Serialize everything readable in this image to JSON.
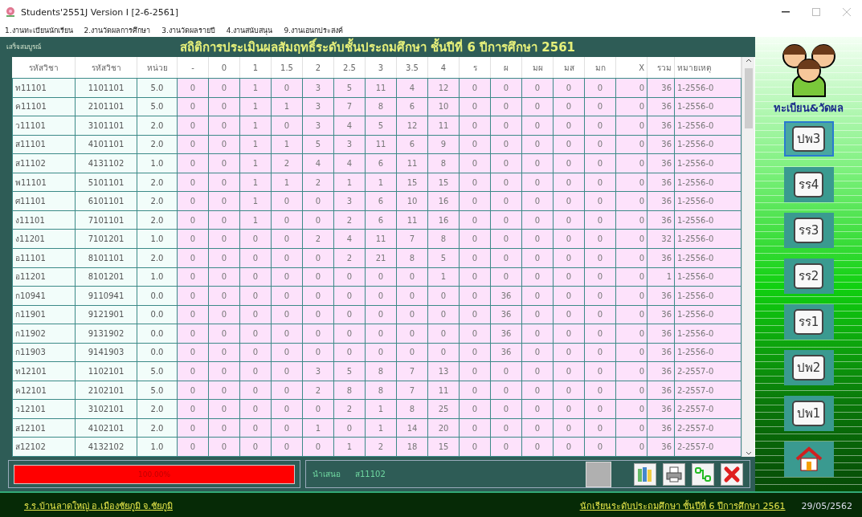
{
  "window": {
    "title": "Students'2551J Version I [2-6-2561]"
  },
  "menu": [
    "1.งานทะเบียนนักเรียน",
    "2.งานวัดผลการศึกษา",
    "3.งานวัดผลรายปี",
    "4.งานสนับสนุน",
    "9.งานเอนกประสงค์"
  ],
  "header": {
    "status": "เสร็จสมบูรณ์",
    "title": "สถิติการประเมินผลสัมฤทธิ์ระดับชั้นประถมศึกษา  ชั้นปีที่ 6  ปีการศึกษา 2561"
  },
  "table": {
    "columns": [
      "รหัสวิชา",
      "รหัสวิชา",
      "หน่วย",
      "-",
      "0",
      "1",
      "1.5",
      "2",
      "2.5",
      "3",
      "3.5",
      "4",
      "ร",
      "ผ",
      "มผ",
      "มส",
      "มก",
      "X",
      "รวม",
      "หมายเหตุ"
    ],
    "rows": [
      [
        "ท11101",
        "1101101",
        "5.0",
        "0",
        "0",
        "1",
        "0",
        "3",
        "5",
        "11",
        "4",
        "12",
        "0",
        "0",
        "0",
        "0",
        "0",
        "0",
        "36",
        "1-2556-0"
      ],
      [
        "ค11101",
        "2101101",
        "5.0",
        "0",
        "0",
        "1",
        "1",
        "3",
        "7",
        "8",
        "6",
        "10",
        "0",
        "0",
        "0",
        "0",
        "0",
        "0",
        "36",
        "1-2556-0"
      ],
      [
        "ว11101",
        "3101101",
        "2.0",
        "0",
        "0",
        "1",
        "0",
        "3",
        "4",
        "5",
        "12",
        "11",
        "0",
        "0",
        "0",
        "0",
        "0",
        "0",
        "36",
        "1-2556-0"
      ],
      [
        "ส11101",
        "4101101",
        "2.0",
        "0",
        "0",
        "1",
        "1",
        "5",
        "3",
        "11",
        "6",
        "9",
        "0",
        "0",
        "0",
        "0",
        "0",
        "0",
        "36",
        "1-2556-0"
      ],
      [
        "ส11102",
        "4131102",
        "1.0",
        "0",
        "0",
        "1",
        "2",
        "4",
        "4",
        "6",
        "11",
        "8",
        "0",
        "0",
        "0",
        "0",
        "0",
        "0",
        "36",
        "1-2556-0"
      ],
      [
        "พ11101",
        "5101101",
        "2.0",
        "0",
        "0",
        "1",
        "1",
        "2",
        "1",
        "1",
        "15",
        "15",
        "0",
        "0",
        "0",
        "0",
        "0",
        "0",
        "36",
        "1-2556-0"
      ],
      [
        "ศ11101",
        "6101101",
        "2.0",
        "0",
        "0",
        "1",
        "0",
        "0",
        "3",
        "6",
        "10",
        "16",
        "0",
        "0",
        "0",
        "0",
        "0",
        "0",
        "36",
        "1-2556-0"
      ],
      [
        "ง11101",
        "7101101",
        "2.0",
        "0",
        "0",
        "1",
        "0",
        "0",
        "2",
        "6",
        "11",
        "16",
        "0",
        "0",
        "0",
        "0",
        "0",
        "0",
        "36",
        "1-2556-0"
      ],
      [
        "ง11201",
        "7101201",
        "1.0",
        "0",
        "0",
        "0",
        "0",
        "2",
        "4",
        "11",
        "7",
        "8",
        "0",
        "0",
        "0",
        "0",
        "0",
        "0",
        "32",
        "1-2556-0"
      ],
      [
        "อ11101",
        "8101101",
        "2.0",
        "0",
        "0",
        "0",
        "0",
        "0",
        "2",
        "21",
        "8",
        "5",
        "0",
        "0",
        "0",
        "0",
        "0",
        "0",
        "36",
        "1-2556-0"
      ],
      [
        "อ11201",
        "8101201",
        "1.0",
        "0",
        "0",
        "0",
        "0",
        "0",
        "0",
        "0",
        "0",
        "1",
        "0",
        "0",
        "0",
        "0",
        "0",
        "0",
        "1",
        "1-2556-0"
      ],
      [
        "ก10941",
        "9110941",
        "0.0",
        "0",
        "0",
        "0",
        "0",
        "0",
        "0",
        "0",
        "0",
        "0",
        "0",
        "36",
        "0",
        "0",
        "0",
        "0",
        "36",
        "1-2556-0"
      ],
      [
        "ก11901",
        "9121901",
        "0.0",
        "0",
        "0",
        "0",
        "0",
        "0",
        "0",
        "0",
        "0",
        "0",
        "0",
        "36",
        "0",
        "0",
        "0",
        "0",
        "36",
        "1-2556-0"
      ],
      [
        "ก11902",
        "9131902",
        "0.0",
        "0",
        "0",
        "0",
        "0",
        "0",
        "0",
        "0",
        "0",
        "0",
        "0",
        "36",
        "0",
        "0",
        "0",
        "0",
        "36",
        "1-2556-0"
      ],
      [
        "ก11903",
        "9141903",
        "0.0",
        "0",
        "0",
        "0",
        "0",
        "0",
        "0",
        "0",
        "0",
        "0",
        "0",
        "36",
        "0",
        "0",
        "0",
        "0",
        "36",
        "1-2556-0"
      ],
      [
        "ท12101",
        "1102101",
        "5.0",
        "0",
        "0",
        "0",
        "0",
        "3",
        "5",
        "8",
        "7",
        "13",
        "0",
        "0",
        "0",
        "0",
        "0",
        "0",
        "36",
        "2-2557-0"
      ],
      [
        "ค12101",
        "2102101",
        "5.0",
        "0",
        "0",
        "0",
        "0",
        "2",
        "8",
        "8",
        "7",
        "11",
        "0",
        "0",
        "0",
        "0",
        "0",
        "0",
        "36",
        "2-2557-0"
      ],
      [
        "ว12101",
        "3102101",
        "2.0",
        "0",
        "0",
        "0",
        "0",
        "0",
        "2",
        "1",
        "8",
        "25",
        "0",
        "0",
        "0",
        "0",
        "0",
        "0",
        "36",
        "2-2557-0"
      ],
      [
        "ส12101",
        "4102101",
        "2.0",
        "0",
        "0",
        "0",
        "0",
        "1",
        "0",
        "1",
        "14",
        "20",
        "0",
        "0",
        "0",
        "0",
        "0",
        "0",
        "36",
        "2-2557-0"
      ],
      [
        "ส12102",
        "4132102",
        "1.0",
        "0",
        "0",
        "0",
        "0",
        "0",
        "1",
        "2",
        "18",
        "15",
        "0",
        "0",
        "0",
        "0",
        "0",
        "0",
        "36",
        "2-2557-0"
      ]
    ]
  },
  "progress": {
    "level": 1.0,
    "text": "100.00%"
  },
  "info": {
    "label": "นำเสนอ",
    "value": "ส11102"
  },
  "sidebar": {
    "title": "ทะเบียน&วัดผล",
    "buttons": [
      {
        "label": "ปพ3",
        "selected": true
      },
      {
        "label": "รร4",
        "selected": false
      },
      {
        "label": "รร3",
        "selected": false
      },
      {
        "label": "รร2",
        "selected": false
      },
      {
        "label": "รร1",
        "selected": false
      },
      {
        "label": "ปพ2",
        "selected": false
      },
      {
        "label": "ปพ1",
        "selected": false
      }
    ]
  },
  "status_bar": {
    "school": "ร.ร.บ้านลาดใหญ่  อ.เมืองชัยภูมิ  จ.ชัยภูมิ",
    "level": "นักเรียนระดับประถมศึกษา  ชั้นปีที่ 6  ปีการศึกษา 2561",
    "date": "29/05/2562"
  }
}
